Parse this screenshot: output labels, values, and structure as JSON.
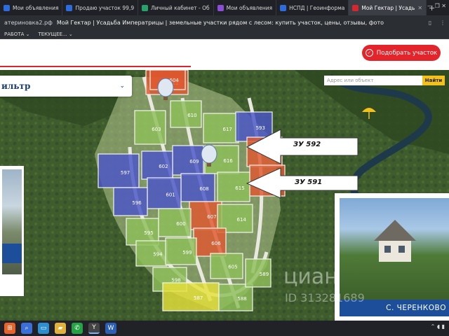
{
  "browser": {
    "tabs": [
      {
        "label": "Мои объявления",
        "color": "#2d6cdf"
      },
      {
        "label": "Продаю участок 99,9",
        "color": "#2d6cdf"
      },
      {
        "label": "Личный кабинет - Об",
        "color": "#27a36a"
      },
      {
        "label": "Мои объявления",
        "color": "#8b4fd6"
      },
      {
        "label": "НСПД | Геоинформа",
        "color": "#2d6cdf"
      },
      {
        "label": "Мой Гектар | Усадь",
        "color": "#d8262e",
        "active": true
      }
    ],
    "address_domain": "атериновка2.рф",
    "page_title": "Мой Гектар | Усадьба Императрицы | земельные участки рядом с лесом: купить участок, цены, отзывы, фото",
    "bookmarks": [
      "РАБОТА ⌄",
      "ТЕКУЩЕЕ... ⌄"
    ]
  },
  "site": {
    "pick_button": "Подобрать участок",
    "filter_label": "ильтр",
    "search_placeholder": "Адрес или объект",
    "search_button": "Найти"
  },
  "map": {
    "callouts": [
      "ЗУ 592",
      "ЗУ 591"
    ],
    "plots": [
      {
        "label": "611",
        "status": "sold"
      },
      {
        "label": "610",
        "status": "free"
      },
      {
        "label": "603",
        "status": "free"
      },
      {
        "label": "617",
        "status": "free"
      },
      {
        "label": "593",
        "status": "reserved"
      },
      {
        "label": "592",
        "status": "sold"
      },
      {
        "label": "591",
        "status": "sold"
      },
      {
        "label": "609",
        "status": "reserved"
      },
      {
        "label": "602",
        "status": "reserved"
      },
      {
        "label": "616",
        "status": "free"
      },
      {
        "label": "597",
        "status": "reserved"
      },
      {
        "label": "608",
        "status": "reserved"
      },
      {
        "label": "601",
        "status": "reserved"
      },
      {
        "label": "596",
        "status": "reserved"
      },
      {
        "label": "615",
        "status": "free"
      },
      {
        "label": "607",
        "status": "sold"
      },
      {
        "label": "595",
        "status": "free"
      },
      {
        "label": "600",
        "status": "free"
      },
      {
        "label": "614",
        "status": "free"
      },
      {
        "label": "606",
        "status": "sold"
      },
      {
        "label": "594",
        "status": "free"
      },
      {
        "label": "599",
        "status": "free"
      },
      {
        "label": "605",
        "status": "free"
      },
      {
        "label": "598",
        "status": "free"
      },
      {
        "label": "587",
        "status": "special"
      },
      {
        "label": "588",
        "status": "free"
      },
      {
        "label": "589",
        "status": "free"
      },
      {
        "label": "604",
        "status": "sold"
      }
    ],
    "colors": {
      "free": "#8fbf5a",
      "sold": "#e0582f",
      "reserved": "#4a55c8",
      "special": "#e6e23a"
    }
  },
  "cards": {
    "right_title": "С. ЧЕРЕНКОВО"
  },
  "watermark": {
    "brand": "циан",
    "id_text": "ID 313281689"
  },
  "taskbar": {
    "icons": [
      "start-icon",
      "search-icon",
      "task-view-icon",
      "explorer-icon",
      "whatsapp-icon",
      "yandex-browser-icon",
      "word-icon"
    ]
  }
}
